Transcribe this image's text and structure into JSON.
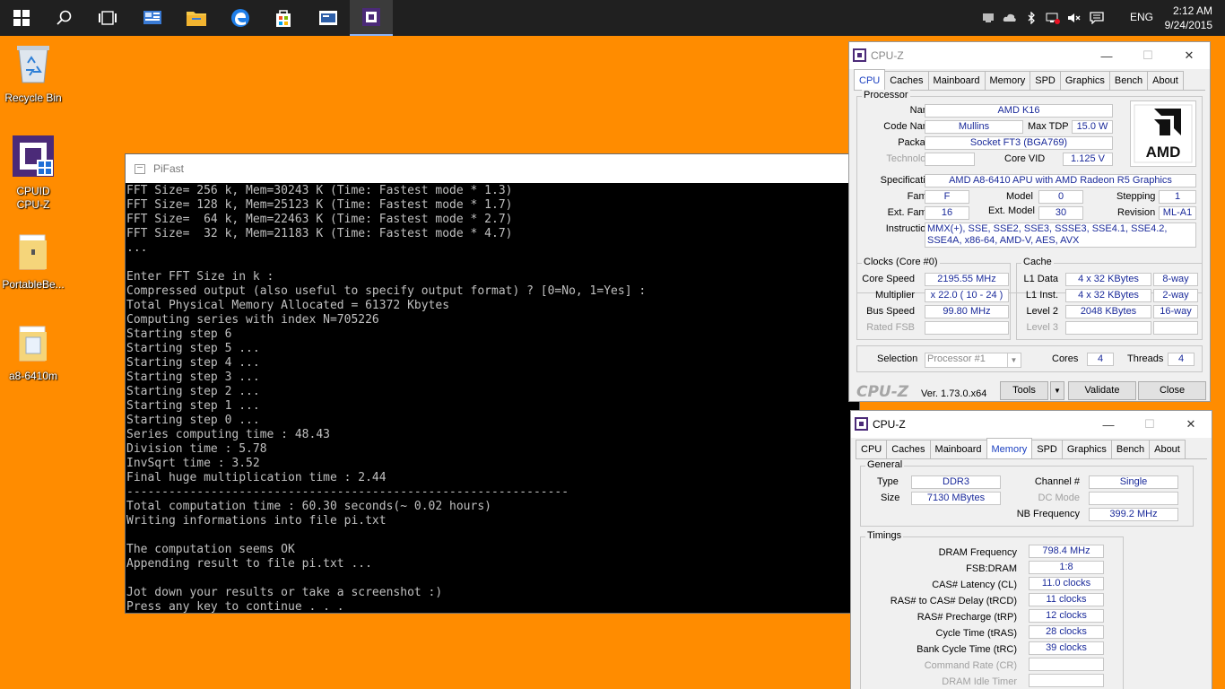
{
  "taskbar": {
    "time": "2:12 AM",
    "date": "9/24/2015",
    "language": "ENG",
    "icons": [
      "windows-start-icon",
      "search-icon",
      "task-view-icon",
      "network-app-icon",
      "file-explorer-icon",
      "edge-icon",
      "store-icon",
      "screen-app-icon",
      "cpuz-taskbar-icon"
    ],
    "tray_icons": [
      "hardware-icon",
      "cloud-icon",
      "bluetooth-icon",
      "network-icon",
      "volume-muted-icon",
      "action-center-icon"
    ]
  },
  "desktop": {
    "icons": [
      {
        "label": "Recycle Bin",
        "icon": "recycle-bin-icon"
      },
      {
        "label": "CPUID\nCPU-Z",
        "icon": "cpuz-icon"
      },
      {
        "label": "PortableBe...",
        "icon": "folder-icon"
      },
      {
        "label": "a8-6410m",
        "icon": "folder-icon"
      }
    ]
  },
  "pifast": {
    "title": "PiFast",
    "output": "FFT Size= 256 k, Mem=30243 K (Time: Fastest mode * 1.3)\nFFT Size= 128 k, Mem=25123 K (Time: Fastest mode * 1.7)\nFFT Size=  64 k, Mem=22463 K (Time: Fastest mode * 2.7)\nFFT Size=  32 k, Mem=21183 K (Time: Fastest mode * 4.7)\n...\n\nEnter FFT Size in k :\nCompressed output (also useful to specify output format) ? [0=No, 1=Yes] :\nTotal Physical Memory Allocated = 61372 Kbytes\nComputing series with index N=705226\nStarting step 6\nStarting step 5 ...\nStarting step 4 ...\nStarting step 3 ...\nStarting step 2 ...\nStarting step 1 ...\nStarting step 0 ...\nSeries computing time : 48.43\nDivision time : 5.78\nInvSqrt time : 3.52\nFinal huge multiplication time : 2.44\n---------------------------------------------------------------\nTotal computation time : 60.30 seconds(~ 0.02 hours)\nWriting informations into file pi.txt\n\nThe computation seems OK\nAppending result to file pi.txt ...\n\nJot down your results or take a screenshot :)\nPress any key to continue . . ."
  },
  "cpuz1": {
    "title": "CPU-Z",
    "tabs": [
      "CPU",
      "Caches",
      "Mainboard",
      "Memory",
      "SPD",
      "Graphics",
      "Bench",
      "About"
    ],
    "processor": {
      "group": "Processor",
      "name_label": "Name",
      "name": "AMD K16",
      "codename_label": "Code Name",
      "codename": "Mullins",
      "maxtdp_label": "Max TDP",
      "maxtdp": "15.0 W",
      "package_label": "Package",
      "package": "Socket FT3 (BGA769)",
      "technology_label": "Technology",
      "technology": "",
      "corevid_label": "Core VID",
      "corevid": "1.125 V",
      "spec_label": "Specification",
      "spec": "AMD A8-6410 APU with AMD Radeon R5 Graphics",
      "family_label": "Family",
      "family": "F",
      "model_label": "Model",
      "model": "0",
      "stepping_label": "Stepping",
      "stepping": "1",
      "extfamily_label": "Ext. Family",
      "extfamily": "16",
      "extmodel_label": "Ext. Model",
      "extmodel": "30",
      "revision_label": "Revision",
      "revision": "ML-A1",
      "instructions_label": "Instructions",
      "instructions": "MMX(+), SSE, SSE2, SSE3, SSSE3, SSE4.1, SSE4.2, SSE4A, x86-64, AMD-V, AES, AVX",
      "logo_text": "AMD"
    },
    "clocks": {
      "group": "Clocks (Core #0)",
      "corespeed_label": "Core Speed",
      "corespeed": "2195.55 MHz",
      "multiplier_label": "Multiplier",
      "multiplier": "x 22.0 ( 10 - 24 )",
      "busspeed_label": "Bus Speed",
      "busspeed": "99.80 MHz",
      "ratedfsb_label": "Rated FSB",
      "ratedfsb": ""
    },
    "cache": {
      "group": "Cache",
      "l1d_label": "L1 Data",
      "l1d": "4 x 32 KBytes",
      "l1d_way": "8-way",
      "l1i_label": "L1 Inst.",
      "l1i": "4 x 32 KBytes",
      "l1i_way": "2-way",
      "l2_label": "Level 2",
      "l2": "2048 KBytes",
      "l2_way": "16-way",
      "l3_label": "Level 3",
      "l3": "",
      "l3_way": ""
    },
    "footer": {
      "selection_label": "Selection",
      "selection": "Processor #1",
      "cores_label": "Cores",
      "cores": "4",
      "threads_label": "Threads",
      "threads": "4",
      "brand": "CPU-Z",
      "version": "Ver. 1.73.0.x64",
      "tools": "Tools",
      "validate": "Validate",
      "close": "Close"
    }
  },
  "cpuz2": {
    "title": "CPU-Z",
    "tabs": [
      "CPU",
      "Caches",
      "Mainboard",
      "Memory",
      "SPD",
      "Graphics",
      "Bench",
      "About"
    ],
    "general": {
      "group": "General",
      "type_label": "Type",
      "type": "DDR3",
      "size_label": "Size",
      "size": "7130 MBytes",
      "channel_label": "Channel #",
      "channel": "Single",
      "dcmode_label": "DC Mode",
      "dcmode": "",
      "nbfreq_label": "NB Frequency",
      "nbfreq": "399.2 MHz"
    },
    "timings": {
      "group": "Timings",
      "rows": [
        {
          "label": "DRAM Frequency",
          "value": "798.4 MHz",
          "dim": false
        },
        {
          "label": "FSB:DRAM",
          "value": "1:8",
          "dim": false
        },
        {
          "label": "CAS# Latency (CL)",
          "value": "11.0 clocks",
          "dim": false
        },
        {
          "label": "RAS# to CAS# Delay (tRCD)",
          "value": "11 clocks",
          "dim": false
        },
        {
          "label": "RAS# Precharge (tRP)",
          "value": "12 clocks",
          "dim": false
        },
        {
          "label": "Cycle Time (tRAS)",
          "value": "28 clocks",
          "dim": false
        },
        {
          "label": "Bank Cycle Time (tRC)",
          "value": "39 clocks",
          "dim": false
        },
        {
          "label": "Command Rate (CR)",
          "value": "",
          "dim": true
        },
        {
          "label": "DRAM Idle Timer",
          "value": "",
          "dim": true
        }
      ]
    }
  }
}
